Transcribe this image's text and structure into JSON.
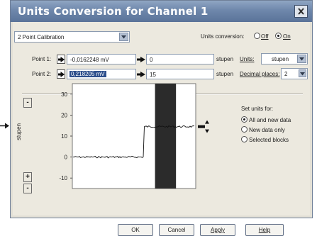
{
  "window": {
    "title": "Units Conversion for Channel 1"
  },
  "calibration": {
    "mode_value": "2 Point Calibration"
  },
  "units_conversion": {
    "label": "Units conversion:",
    "off_label": "Off",
    "on_label": "On",
    "selected": "on"
  },
  "point1": {
    "label": "Point 1:",
    "raw_value": "-0,0162248 mV",
    "converted_value": "0",
    "unit": "stupen"
  },
  "point2": {
    "label": "Point 2:",
    "raw_value": "0,218205 mV",
    "converted_value": "15",
    "unit": "stupen"
  },
  "units": {
    "label": "Units:",
    "value": "stupen"
  },
  "decimal_places": {
    "label": "Decimal places:",
    "value": "2"
  },
  "plot": {
    "ylabel": "stupen",
    "y_ticks": [
      "30",
      "20",
      "10",
      "0",
      "-10"
    ],
    "ylim": [
      -15,
      35
    ],
    "step_level_before": 0,
    "step_level_after": 14.5,
    "step_fraction": 0.58,
    "selection_fraction": [
      0.67,
      0.84
    ],
    "zoom_in_label": "+",
    "zoom_out_label": "-"
  },
  "set_units": {
    "label": "Set units for:",
    "options": [
      "All and new data",
      "New data only",
      "Selected blocks"
    ],
    "selected": 0
  },
  "buttons": {
    "ok": "OK",
    "cancel": "Cancel",
    "apply": "Apply",
    "help": "Help"
  },
  "colors": {
    "title_bar": "#6e87ab",
    "selection_region": "#2b2b2b",
    "highlight": "#2d4f8c"
  },
  "icons": [
    "right-arrow-icon",
    "close-icon",
    "chevron-down-icon",
    "marker-arrows-icon"
  ]
}
